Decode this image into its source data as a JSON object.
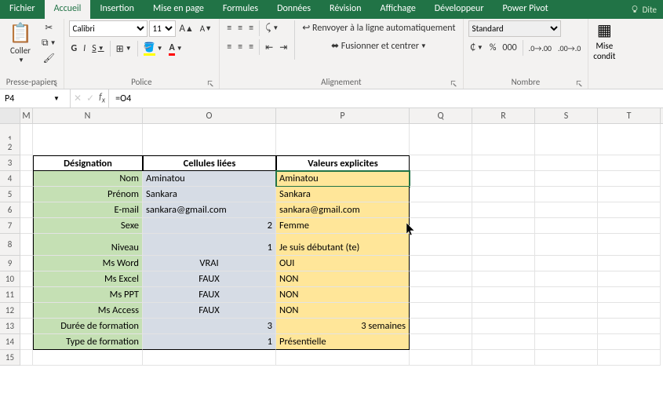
{
  "tabs": [
    "Fichier",
    "Accueil",
    "Insertion",
    "Mise en page",
    "Formules",
    "Données",
    "Révision",
    "Affichage",
    "Développeur",
    "Power Pivot"
  ],
  "active_tab": 1,
  "user_hint": "Dite",
  "ribbon": {
    "paste": "Coller",
    "groups": {
      "clipboard": "Presse-papiers",
      "font": "Police",
      "align": "Alignement",
      "number": "Nombre",
      "style": "Mise\ncondit"
    },
    "font_name": "Calibri",
    "font_size": "11",
    "bold": "G",
    "italic": "I",
    "underline": "S",
    "wrap": "Renvoyer à la ligne automatiquement",
    "merge": "Fusionner et centrer",
    "num_format": "Standard"
  },
  "name_box": "P4",
  "formula": "=O4",
  "columns": [
    "M",
    "N",
    "O",
    "P",
    "Q",
    "R",
    "S",
    "T"
  ],
  "colw": [
    "cM",
    "cN",
    "cO",
    "cP",
    "cQ",
    "cR",
    "cS",
    "cT"
  ],
  "rows": [
    1,
    2,
    3,
    4,
    5,
    6,
    7,
    8,
    9,
    10,
    11,
    12,
    13,
    14,
    15
  ],
  "table": {
    "header": {
      "n": "Désignation",
      "o": "Cellules liées",
      "p": "Valeurs explicites"
    },
    "r4": {
      "n": "Nom",
      "o": "Aminatou",
      "p": "Aminatou"
    },
    "r5": {
      "n": "Prénom",
      "o": "Sankara",
      "p": "Sankara"
    },
    "r6": {
      "n": "E-mail",
      "o": "sankara@gmail.com",
      "p": "sankara@gmail.com"
    },
    "r7": {
      "n": "Sexe",
      "o": "2",
      "p": "Femme"
    },
    "r8": {
      "n": "Niveau",
      "o": "1",
      "p": "Je suis débutant (te)"
    },
    "r9": {
      "n": "Ms Word",
      "o": "VRAI",
      "p": "OUI"
    },
    "r10": {
      "n": "Ms Excel",
      "o": "FAUX",
      "p": "NON"
    },
    "r11": {
      "n": "Ms PPT",
      "o": "FAUX",
      "p": "NON"
    },
    "r12": {
      "n": "Ms Access",
      "o": "FAUX",
      "p": "NON"
    },
    "r13": {
      "n": "Durée de formation",
      "o": "3",
      "p": "3 semaines"
    },
    "r14": {
      "n": "Type de formation",
      "o": "1",
      "p": "Présentielle"
    }
  }
}
